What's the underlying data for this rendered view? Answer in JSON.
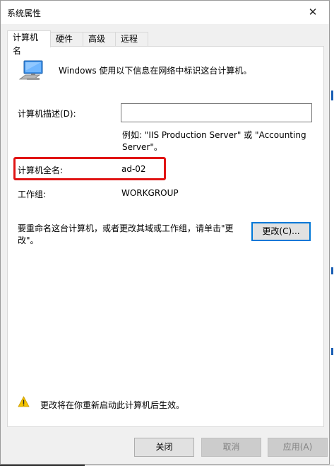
{
  "window": {
    "title": "系统属性",
    "close_glyph": "✕"
  },
  "tabs": [
    {
      "label": "计算机名",
      "active": true
    },
    {
      "label": "硬件",
      "active": false
    },
    {
      "label": "高级",
      "active": false
    },
    {
      "label": "远程",
      "active": false
    }
  ],
  "main": {
    "intro": "Windows 使用以下信息在网络中标识这台计算机。",
    "description_label": "计算机描述(D):",
    "description_value": "",
    "example_line1": "例如: \"IIS Production Server\" 或 \"Accounting",
    "example_line2": "Server\"。",
    "full_name_label": "计算机全名:",
    "full_name_value": "ad-02",
    "workgroup_label": "工作组:",
    "workgroup_value": "WORKGROUP",
    "rename_line1": "要重命名这台计算机，或者更改其域或工作组，请单击\"更",
    "rename_line2": "改\"。",
    "change_button": "更改(C)...",
    "warning_text": "更改将在你重新启动此计算机后生效。"
  },
  "footer": {
    "close_button": "关闭",
    "cancel_button": "取消",
    "apply_button": "应用(A)"
  },
  "colors": {
    "highlight": "#e01414",
    "focus_border": "#0078d7",
    "warning": "#f5c400"
  },
  "icons": {
    "computer": "computer-icon",
    "warning": "warning-icon"
  }
}
